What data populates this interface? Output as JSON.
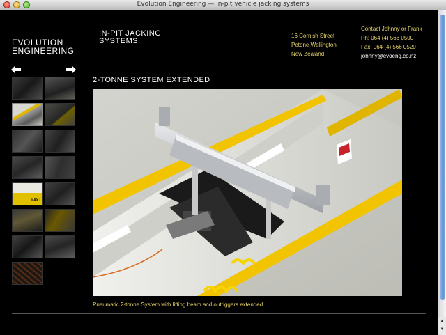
{
  "window": {
    "title": "Evolution Engineering — In-pit vehicle jacking systems"
  },
  "logo": {
    "line1": "EVOLUTION",
    "line2": "ENGINEERING"
  },
  "heading": {
    "line1": "IN-PIT JACKING",
    "line2": "SYSTEMS"
  },
  "address": {
    "line1": "16 Cornish Street",
    "line2": "Petone Wellington",
    "line3": "New Zealand"
  },
  "contact": {
    "line1": "Contact Johnny or Frank",
    "phone": "Ph: 064 (4) 566 0500",
    "fax": "Fax: 064 (4) 566 0520",
    "email": "johnny@evoeng.co.nz"
  },
  "nav": {
    "prev_icon": "left-arrow-icon",
    "next_icon": "right-arrow-icon"
  },
  "gallery": {
    "title": "2-TONNE SYSTEM EXTENDED",
    "caption": "Pneumatic 2-tonne System with lifting beam and outriggers extended.",
    "thumb_label_text": "MAX L",
    "thumbnail_count": 15
  },
  "colors": {
    "accent_yellow": "#e8d56a",
    "background": "#000000",
    "beam_yellow": "#f2c400"
  }
}
